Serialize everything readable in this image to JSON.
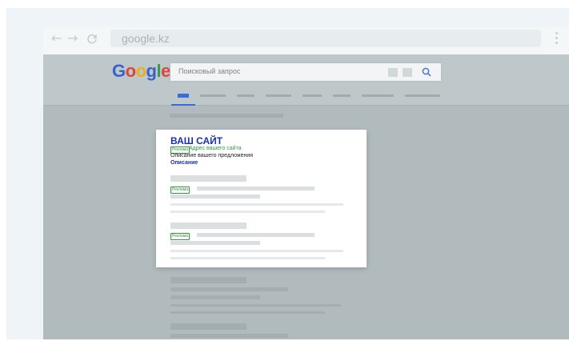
{
  "browser": {
    "back_icon": "←",
    "forward_icon": "→",
    "reload_icon": "C",
    "url": "google.kz"
  },
  "search": {
    "logo_letters": [
      {
        "char": "G",
        "color": "#3b62c8"
      },
      {
        "char": "o",
        "color": "#d9473c"
      },
      {
        "char": "o",
        "color": "#e9b01f"
      },
      {
        "char": "g",
        "color": "#3b62c8"
      },
      {
        "char": "l",
        "color": "#3c9b4b"
      },
      {
        "char": "e",
        "color": "#d9473c"
      }
    ],
    "placeholder": "Поисковый запрос",
    "accent_color": "#3c6bd8"
  },
  "ad": {
    "title": "ВАШ САЙТ",
    "badge": "Реклама",
    "url": "Адрес вашего сайта",
    "description": "Описание вашего предложения",
    "link": "Описание",
    "badge_color": "#2f9b3c",
    "title_color": "#1a2fb1"
  },
  "placeholder_results": {
    "badge_1": "Реклама",
    "badge_2": "Реклама"
  }
}
